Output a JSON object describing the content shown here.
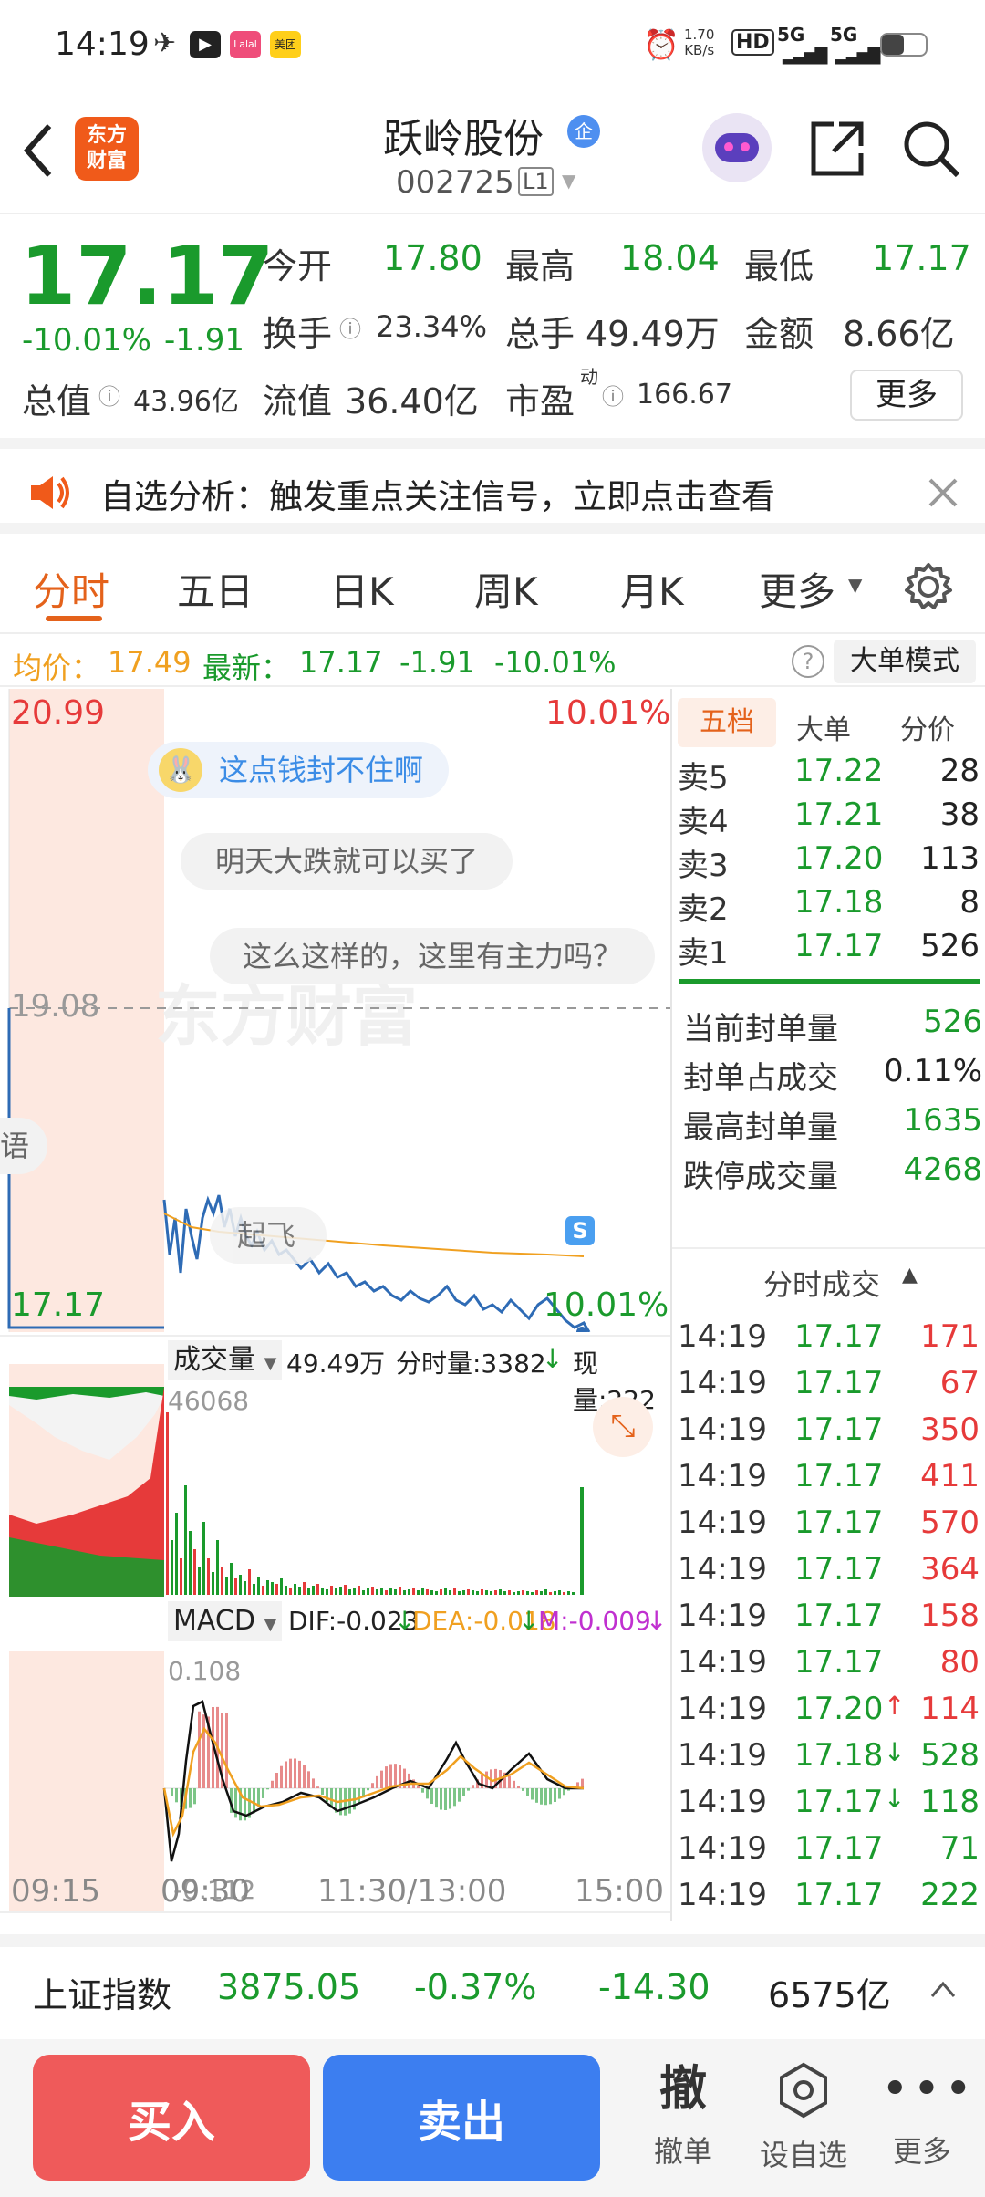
{
  "status": {
    "time": "14:19",
    "speed": "1.70",
    "speed_unit": "KB/s",
    "net1": "5G",
    "net2": "5G",
    "hd": "HD",
    "app_labels": [
      "",
      "",
      "Lalal",
      "美团"
    ]
  },
  "header": {
    "stock_name": "跃岭股份",
    "badge": "企",
    "code": "002725",
    "level": "L1",
    "logo_line1": "东方",
    "logo_line2": "财富"
  },
  "quote": {
    "price": "17.17",
    "pct": "-10.01%",
    "change": "-1.91",
    "open_label": "今开",
    "open": "17.80",
    "high_label": "最高",
    "high": "18.04",
    "low_label": "最低",
    "low": "17.17",
    "turnover_label": "换手",
    "turnover": "23.34%",
    "vol_label": "总手",
    "vol": "49.49万",
    "amount_label": "金额",
    "amount": "8.66亿",
    "mcap_label": "总值",
    "mcap": "43.96亿",
    "float_label": "流值",
    "float": "36.40亿",
    "pe_label": "市盈",
    "pe_sup": "动",
    "pe": "166.67",
    "more": "更多"
  },
  "banner": {
    "text": "自选分析：触发重点关注信号，立即点击查看"
  },
  "tabs": [
    "分时",
    "五日",
    "日K",
    "周K",
    "月K",
    "更多"
  ],
  "infoline": {
    "avg_label": "均价：",
    "avg": "17.49",
    "last_label": "最新：",
    "last": "17.17",
    "chg": "-1.91",
    "pct": "-10.01%",
    "mode": "大单模式"
  },
  "chart": {
    "y_top": "20.99",
    "y_top_pct": "10.01%",
    "ref": "19.08",
    "y_bottom": "17.17",
    "y_bottom_pct": "10.01%",
    "bubbles": [
      "这点钱封不住啊",
      "明天大跌就可以买了",
      "这么这样的，这里有主力吗？",
      "起飞",
      "语"
    ],
    "watermark": "东方财富",
    "s_marker": "S",
    "vol_label": "成交量",
    "vol_total": "49.49万",
    "vol_fs": "分时量:3382",
    "vol_now": "现量:222",
    "vol_max": "46068",
    "macd_label": "MACD",
    "dif": "DIF:-0.023",
    "dea": "DEA:-0.018",
    "m": "M:-0.009",
    "macd_top": "0.108",
    "macd_bottom": "-0.112",
    "times": [
      "09:15",
      "09:30",
      "11:30/13:00",
      "15:00"
    ]
  },
  "orderbook": {
    "tabs": [
      "五档",
      "大单",
      "分价"
    ],
    "asks": [
      {
        "label": "卖5",
        "price": "17.22",
        "vol": "28"
      },
      {
        "label": "卖4",
        "price": "17.21",
        "vol": "38"
      },
      {
        "label": "卖3",
        "price": "17.20",
        "vol": "113"
      },
      {
        "label": "卖2",
        "price": "17.18",
        "vol": "8"
      },
      {
        "label": "卖1",
        "price": "17.17",
        "vol": "526"
      }
    ],
    "stats": [
      {
        "label": "当前封单量",
        "value": "526"
      },
      {
        "label": "封单占成交",
        "value": "0.11%"
      },
      {
        "label": "最高封单量",
        "value": "1635"
      },
      {
        "label": "跌停成交量",
        "value": "4268"
      }
    ],
    "trades_title": "分时成交",
    "trades": [
      {
        "time": "14:19",
        "price": "17.17",
        "arrow": "",
        "vol": "171",
        "vcolor": "#e63a3a"
      },
      {
        "time": "14:19",
        "price": "17.17",
        "arrow": "",
        "vol": "67",
        "vcolor": "#e63a3a"
      },
      {
        "time": "14:19",
        "price": "17.17",
        "arrow": "",
        "vol": "350",
        "vcolor": "#e63a3a"
      },
      {
        "time": "14:19",
        "price": "17.17",
        "arrow": "",
        "vol": "411",
        "vcolor": "#e63a3a"
      },
      {
        "time": "14:19",
        "price": "17.17",
        "arrow": "",
        "vol": "570",
        "vcolor": "#e63a3a"
      },
      {
        "time": "14:19",
        "price": "17.17",
        "arrow": "",
        "vol": "364",
        "vcolor": "#e63a3a"
      },
      {
        "time": "14:19",
        "price": "17.17",
        "arrow": "",
        "vol": "158",
        "vcolor": "#e63a3a"
      },
      {
        "time": "14:19",
        "price": "17.17",
        "arrow": "",
        "vol": "80",
        "vcolor": "#e63a3a"
      },
      {
        "time": "14:19",
        "price": "17.20",
        "arrow": "↑",
        "vol": "114",
        "vcolor": "#e63a3a"
      },
      {
        "time": "14:19",
        "price": "17.18",
        "arrow": "↓",
        "vol": "528",
        "vcolor": "#1a9a2c"
      },
      {
        "time": "14:19",
        "price": "17.17",
        "arrow": "↓",
        "vol": "118",
        "vcolor": "#1a9a2c"
      },
      {
        "time": "14:19",
        "price": "17.17",
        "arrow": "",
        "vol": "71",
        "vcolor": "#1a9a2c"
      },
      {
        "time": "14:19",
        "price": "17.17",
        "arrow": "",
        "vol": "222",
        "vcolor": "#1a9a2c"
      }
    ]
  },
  "index": {
    "name": "上证指数",
    "value": "3875.05",
    "pct": "-0.37%",
    "chg": "-14.30",
    "amount": "6575亿"
  },
  "bottom": {
    "buy": "买入",
    "sell": "卖出",
    "cancel_icon": "撤",
    "cancel": "撤单",
    "watch": "设自选",
    "more": "更多"
  },
  "colors": {
    "up": "#e63a3a",
    "down": "#1a9a2c",
    "accent": "#e4621b",
    "price_line": "#2e6bb5",
    "avg_line": "#f0a020",
    "buy": "#ef5a5a",
    "sell": "#3c7ef0"
  }
}
